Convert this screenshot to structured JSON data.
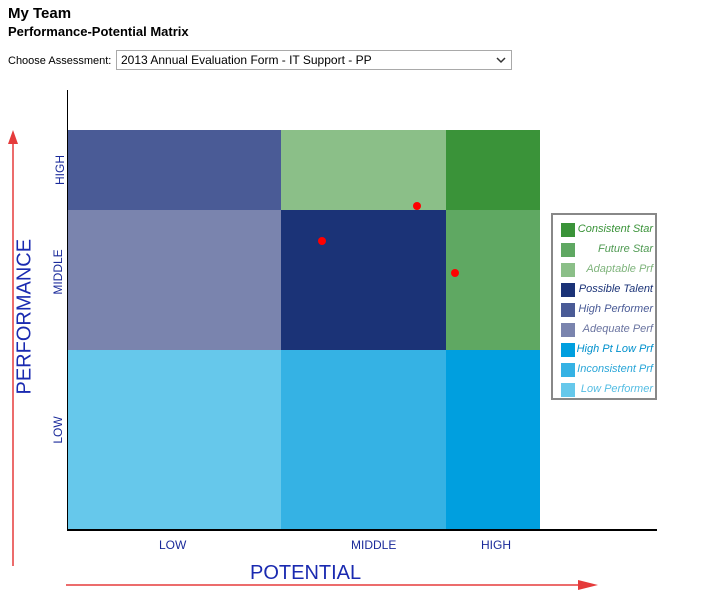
{
  "header": {
    "title": "My Team",
    "subtitle": "Performance-Potential Matrix"
  },
  "assessment": {
    "label": "Choose Assessment:",
    "selected": "2013 Annual Evaluation Form - IT Support - PP"
  },
  "axes": {
    "y_title": "PERFORMANCE",
    "x_title": "POTENTIAL",
    "y_ticks": [
      "HIGH",
      "MIDDLE",
      "LOW"
    ],
    "x_ticks": [
      "LOW",
      "MIDDLE",
      "HIGH"
    ]
  },
  "colors": {
    "consistent_star": "#3a9339",
    "future_star": "#5fa862",
    "adaptable_prf": "#8bbf88",
    "possible_talent": "#1b3377",
    "high_performer": "#4a5b96",
    "adequate_perf": "#7a84ae",
    "high_pt_low_prf": "#009fdf",
    "inconsistent_prf": "#35b2e4",
    "low_performer": "#66c8eb",
    "axis_arrow": "#e53b3b",
    "dot": "#ff0000"
  },
  "legend": [
    {
      "label": "Consistent Star",
      "color": "#3a9339"
    },
    {
      "label": "Future Star",
      "color": "#5fa862"
    },
    {
      "label": "Adaptable Prf",
      "color": "#8bbf88"
    },
    {
      "label": "Possible Talent",
      "color": "#1b3377"
    },
    {
      "label": "High Performer",
      "color": "#4a5b96"
    },
    {
      "label": "Adequate Perf",
      "color": "#7a84ae"
    },
    {
      "label": "High Pt Low Prf",
      "color": "#009fdf"
    },
    {
      "label": "Inconsistent Prf",
      "color": "#35b2e4"
    },
    {
      "label": "Low Performer",
      "color": "#66c8eb"
    }
  ]
}
